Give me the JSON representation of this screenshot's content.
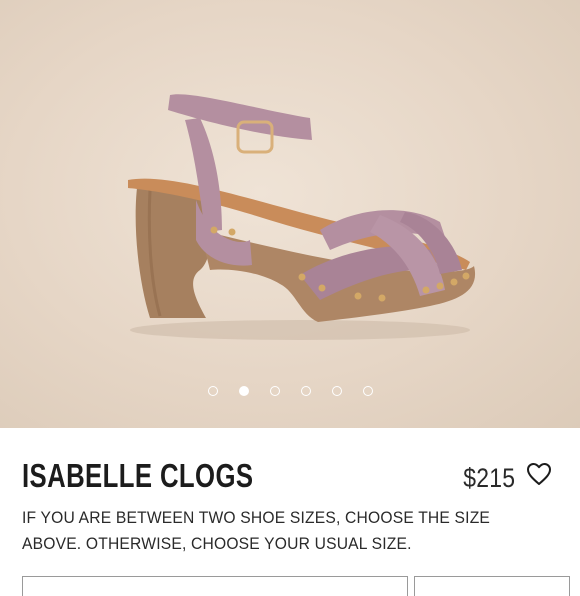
{
  "product": {
    "title": "ISABELLE CLOGS",
    "price": "$215",
    "size_note": "IF YOU ARE BETWEEN TWO SHOE SIZES, CHOOSE THE SIZE ABOVE. OTHERWISE, CHOOSE YOUR USUAL SIZE."
  },
  "gallery": {
    "slide_count": 6,
    "active_index": 1
  },
  "icons": {
    "favorite": "heart-outline-icon"
  },
  "colors": {
    "suede": "#b48fa0",
    "wood": "#a87f5f",
    "background": "#e8d9c9",
    "text": "#1c1c1c"
  }
}
